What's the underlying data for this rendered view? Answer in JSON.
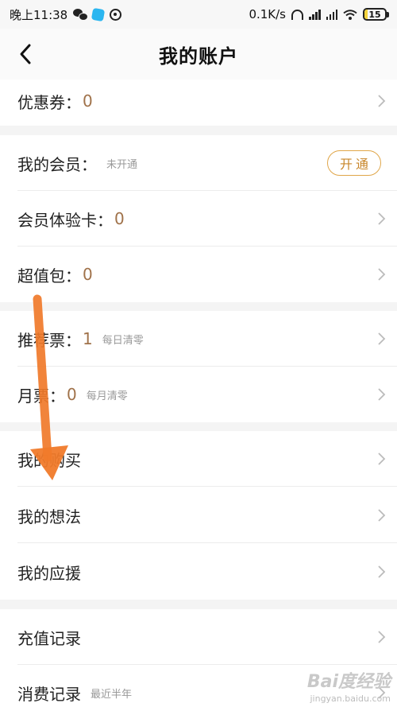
{
  "status_bar": {
    "time": "晚上11:38",
    "speed": "0.1K/s",
    "battery": "15",
    "battery_level": 0.15
  },
  "header": {
    "title": "我的账户"
  },
  "rows": {
    "coupon": {
      "label": "优惠券：",
      "value": "0"
    },
    "membership": {
      "label": "我的会员：",
      "note": "未开通",
      "button": "开通"
    },
    "member_trial_card": {
      "label": "会员体验卡：",
      "value": "0"
    },
    "super_pack": {
      "label": "超值包：",
      "value": "0"
    },
    "recommend_ticket": {
      "label": "推荐票：",
      "value": "1",
      "note": "每日清零"
    },
    "monthly_ticket": {
      "label": "月票：",
      "value": "0",
      "note": "每月清零"
    },
    "my_purchase": {
      "label": "我的购买"
    },
    "my_thoughts": {
      "label": "我的想法"
    },
    "my_support": {
      "label": "我的应援"
    },
    "recharge_record": {
      "label": "充值记录"
    },
    "consume_record": {
      "label": "消费记录",
      "note": "最近半年"
    }
  },
  "watermark": {
    "logo": "Bai度经验",
    "url": "jingyan.baidu.com"
  },
  "colors": {
    "accent": "#c8872b",
    "value": "#a0724a",
    "annotation_arrow": "#f07a2a"
  }
}
